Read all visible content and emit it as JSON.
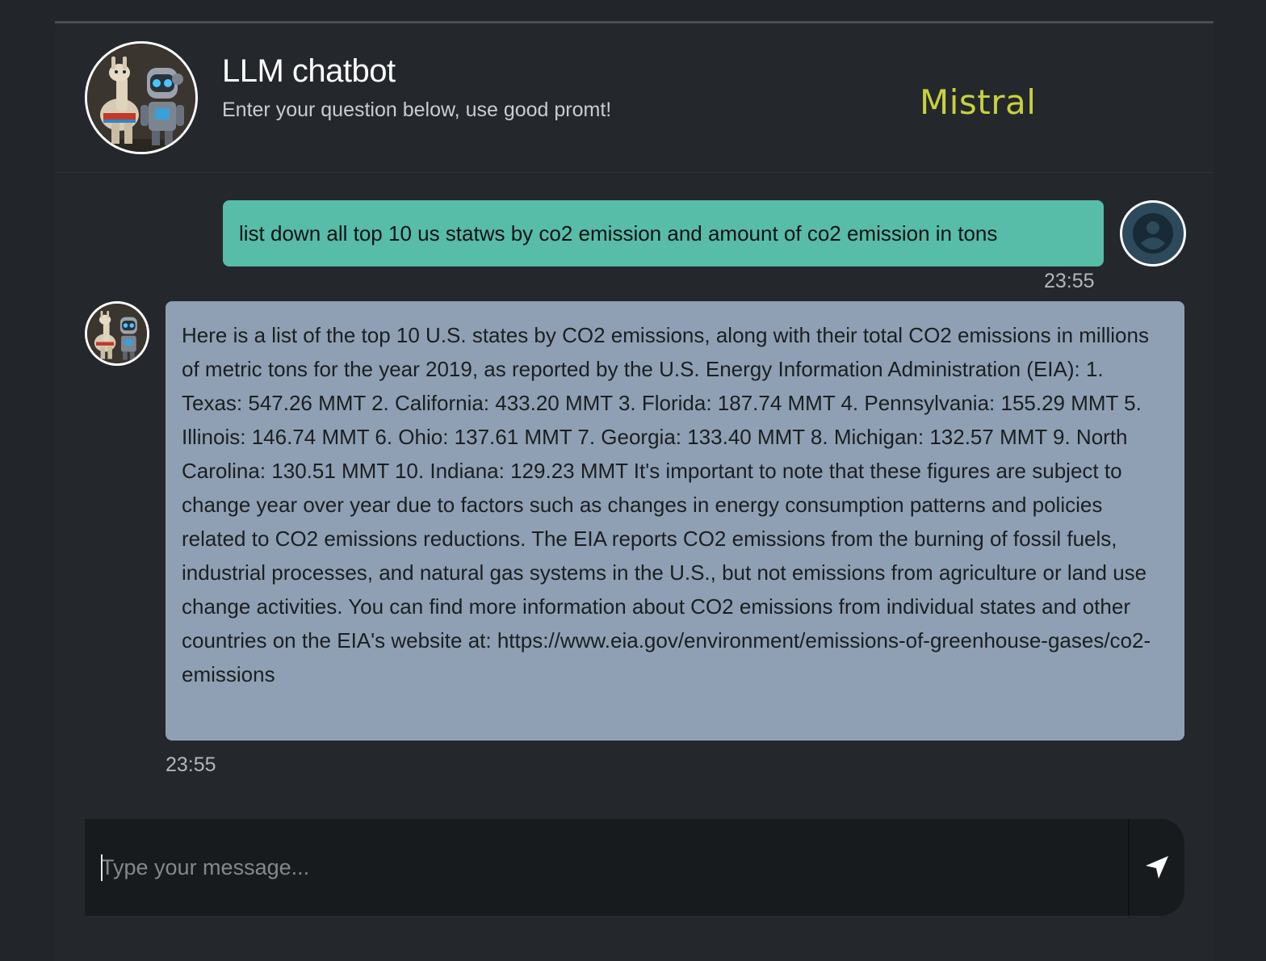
{
  "header": {
    "title": "LLM chatbot",
    "subtitle": "Enter your question below, use good promt!",
    "model_name": "Mistral",
    "avatar_icon": "llama-and-robot-avatar"
  },
  "messages": [
    {
      "role": "user",
      "text": "list down all top 10 us statws by co2 emission and amount of co2 emission in tons",
      "time": "23:55",
      "avatar_icon": "user-avatar-icon"
    },
    {
      "role": "bot",
      "text": "Here is a list of the top 10 U.S. states by CO2 emissions, along with their total CO2 emissions in millions of metric tons for the year 2019, as reported by the U.S. Energy Information Administration (EIA): 1. Texas: 547.26 MMT 2. California: 433.20 MMT 3. Florida: 187.74 MMT 4. Pennsylvania: 155.29 MMT 5. Illinois: 146.74 MMT 6. Ohio: 137.61 MMT 7. Georgia: 133.40 MMT 8. Michigan: 132.57 MMT 9. North Carolina: 130.51 MMT 10. Indiana: 129.23 MMT It's important to note that these figures are subject to change year over year due to factors such as changes in energy consumption patterns and policies related to CO2 emissions reductions. The EIA reports CO2 emissions from the burning of fossil fuels, industrial processes, and natural gas systems in the U.S., but not emissions from agriculture or land use change activities. You can find more information about CO2 emissions from individual states and other countries on the EIA's website at: https://www.eia.gov/environment/emissions-of-greenhouse-gases/co2-emissions",
      "time": "23:55",
      "avatar_icon": "llama-and-robot-avatar"
    }
  ],
  "composer": {
    "placeholder": "Type your message...",
    "value": "",
    "send_icon": "send-arrow-icon"
  },
  "colors": {
    "background": "#22262b",
    "user_bubble": "#57bca8",
    "bot_bubble": "#8fa0b4",
    "model_accent": "#c8d13b"
  }
}
